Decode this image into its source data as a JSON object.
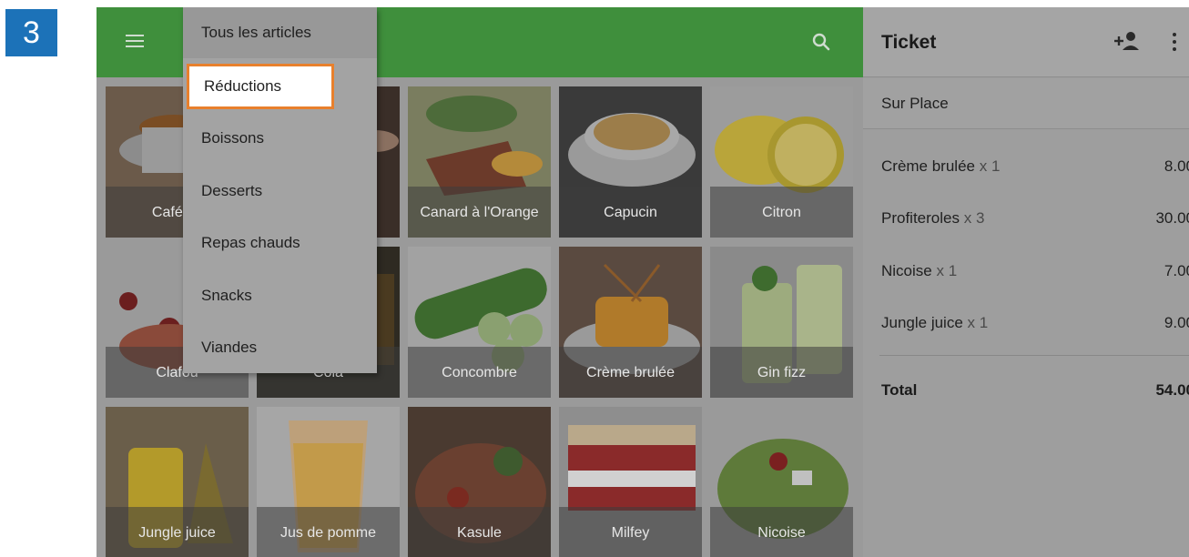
{
  "step_number": "3",
  "topbar": {
    "menu_icon": "hamburger-menu-icon",
    "search_icon": "search-icon",
    "color": "#3f8f3c"
  },
  "category_menu": {
    "items": [
      {
        "label": "Tous les articles"
      },
      {
        "label": "Réductions",
        "highlighted": true
      },
      {
        "label": "Boissons"
      },
      {
        "label": "Desserts"
      },
      {
        "label": "Repas chauds"
      },
      {
        "label": "Snacks"
      },
      {
        "label": "Viandes"
      }
    ],
    "highlight_color": "#e8802d"
  },
  "products": [
    {
      "name": "Café cu"
    },
    {
      "name": "Canard à l'Orange"
    },
    {
      "name": "Capucin"
    },
    {
      "name": "Citron"
    },
    {
      "name": "Clafou"
    },
    {
      "name": "Cola"
    },
    {
      "name": "Concombre"
    },
    {
      "name": "Crème brulée"
    },
    {
      "name": "Gin fizz"
    },
    {
      "name": "Jungle juice"
    },
    {
      "name": "Jus de pomme"
    },
    {
      "name": "Kasule"
    },
    {
      "name": "Milfey"
    },
    {
      "name": "Nicoise"
    }
  ],
  "ticket": {
    "title": "Ticket",
    "add_customer_icon": "add-person-icon",
    "more_icon": "more-vert-icon",
    "dining_option": "Sur Place",
    "lines": [
      {
        "name": "Crème brulée",
        "qty": "x 1",
        "price": "8.00"
      },
      {
        "name": "Profiteroles",
        "qty": "x 3",
        "price": "30.00"
      },
      {
        "name": "Nicoise",
        "qty": "x 1",
        "price": "7.00"
      },
      {
        "name": "Jungle juice",
        "qty": "x 1",
        "price": "9.00"
      }
    ],
    "total_label": "Total",
    "total_value": "54.00"
  }
}
